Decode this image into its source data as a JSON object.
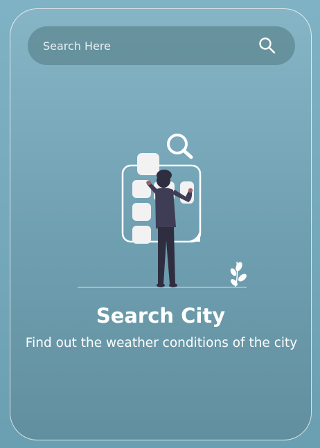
{
  "search": {
    "placeholder": "Search Here",
    "value": "",
    "icon": "search-icon"
  },
  "illustration": {
    "name": "person-searching-city-illustration"
  },
  "main": {
    "title": "Search City",
    "subtitle": "Find out the weather conditions of the city"
  },
  "colors": {
    "background_top": "#86b5c6",
    "background_bottom": "#628f9f",
    "search_bar": "#507880",
    "text": "#ffffff",
    "figure_dark": "#2f2e41",
    "accent_pink": "#a0616a"
  }
}
